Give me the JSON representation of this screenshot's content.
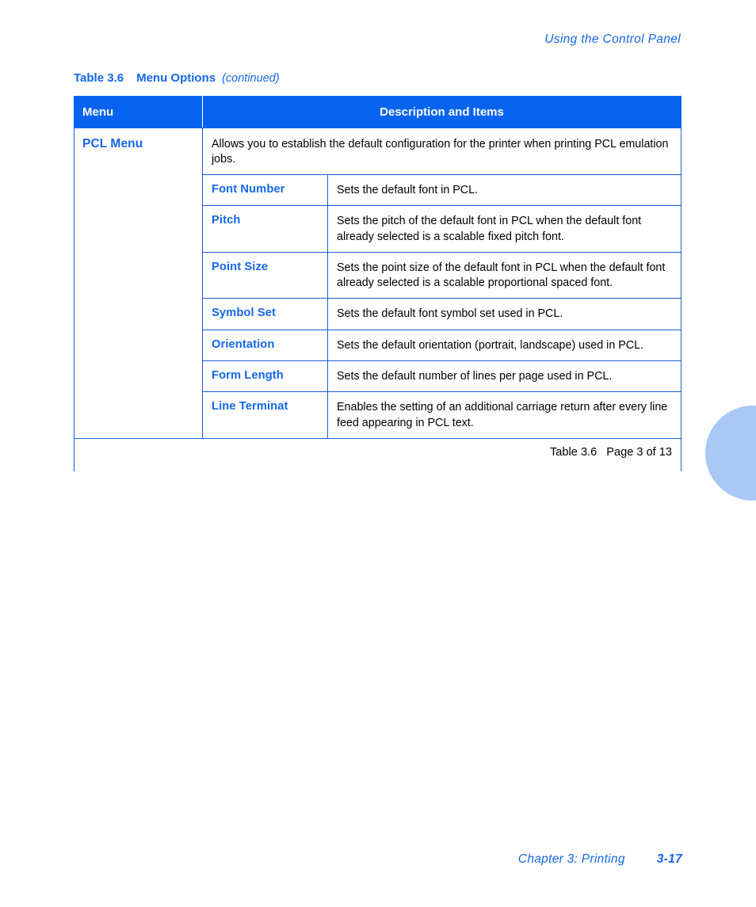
{
  "running_header": "Using the Control Panel",
  "caption": {
    "label": "Table 3.6",
    "title": "Menu Options",
    "continued": "(continued)"
  },
  "table": {
    "columns": [
      "Menu",
      "Description and Items"
    ],
    "menu_group": {
      "name": "PCL Menu",
      "intro": "Allows you to establish the default configuration for the printer when printing PCL emulation jobs.",
      "items": [
        {
          "name": "Font Number",
          "description": "Sets the default font in PCL."
        },
        {
          "name": "Pitch",
          "description": "Sets the pitch of the default font in PCL when the default font already selected is a scalable fixed pitch font."
        },
        {
          "name": "Point Size",
          "description": "Sets the point size of the default font in PCL when the default font already selected is a scalable proportional spaced font."
        },
        {
          "name": "Symbol Set",
          "description": "Sets the default font symbol set used in PCL."
        },
        {
          "name": "Orientation",
          "description": "Sets the default orientation (portrait, landscape) used in PCL."
        },
        {
          "name": "Form Length",
          "description": "Sets the default number of lines per page used in PCL."
        },
        {
          "name": "Line Terminat",
          "description": "Enables the setting of an additional carriage return after every line feed appearing in PCL text."
        }
      ]
    },
    "footer": {
      "table_label": "Table 3.6",
      "page_label": "Page 3 of 13"
    }
  },
  "page_footer": {
    "chapter": "Chapter 3: Printing",
    "folio": "3-17"
  },
  "colors": {
    "header_band": "#0663ef",
    "heading_blue": "#1667e8",
    "border_blue": "#1a5fd0",
    "edge_tab": "#aac8f5",
    "body_text": "#000000"
  }
}
